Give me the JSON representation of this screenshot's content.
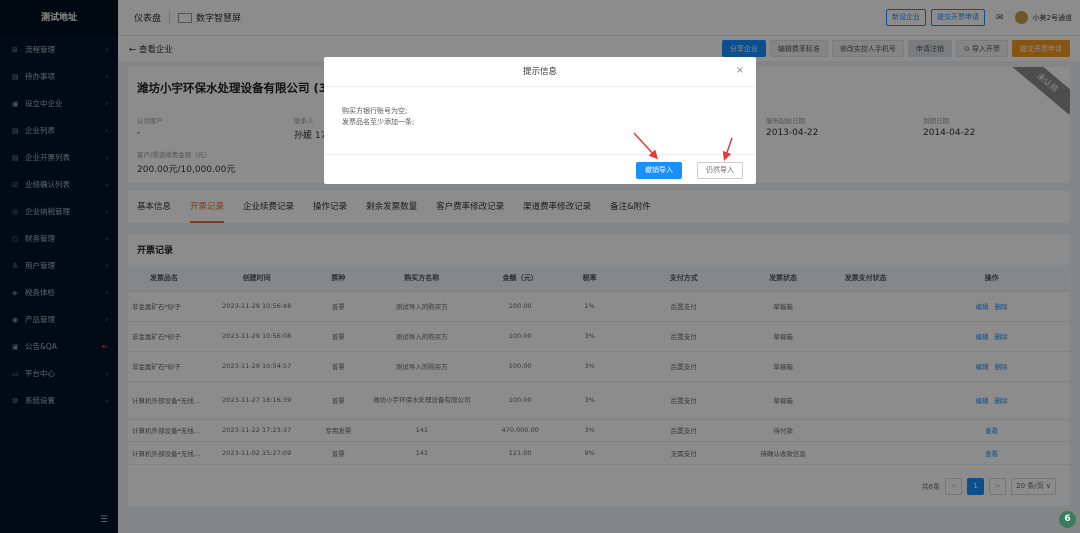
{
  "app": {
    "title": "测试地址"
  },
  "sidebar": {
    "items": [
      {
        "label": "流程管理",
        "icon": "flow-icon"
      },
      {
        "label": "待办事项",
        "icon": "todo-icon"
      },
      {
        "label": "设立中企业",
        "icon": "building-icon"
      },
      {
        "label": "企业列表",
        "icon": "list-icon"
      },
      {
        "label": "企业开票列表",
        "icon": "invoice-icon"
      },
      {
        "label": "业绩确认列表",
        "icon": "check-icon"
      },
      {
        "label": "企业纳税管理",
        "icon": "tax-icon"
      },
      {
        "label": "财务管理",
        "icon": "finance-icon"
      },
      {
        "label": "用户管理",
        "icon": "user-icon"
      },
      {
        "label": "税务体检",
        "icon": "health-icon"
      },
      {
        "label": "产品管理",
        "icon": "product-icon"
      },
      {
        "label": "公告&QA",
        "icon": "notice-icon"
      },
      {
        "label": "平台中心",
        "icon": "platform-icon"
      },
      {
        "label": "系统设置",
        "icon": "settings-icon"
      }
    ],
    "collapse_icon": "collapse-menu-icon"
  },
  "header": {
    "tab1": "仪表盘",
    "tab2": "数字智慧屏",
    "btn_new": "新设企业",
    "btn_invoice": "提交开票申请",
    "user": "小美2号通道"
  },
  "subbar": {
    "back": "← 查看企业",
    "actions": [
      "分享企业",
      "编辑费率标准",
      "修改实控人手机号",
      "申请注销",
      "⊙ 导入开票",
      "提交开票申请"
    ]
  },
  "company": {
    "name": "潍坊小宇环保水处理设备有限公司 (37",
    "badge": "未认领",
    "fields": [
      {
        "k": "认领客户",
        "v": "-"
      },
      {
        "k": "联系人",
        "v": "孙媛 17"
      },
      {
        "k": "服务起始日期",
        "v": "2013-04-22"
      },
      {
        "k": "到期日期",
        "v": "2014-04-22"
      },
      {
        "k": "客户/渠道续费金额（元）",
        "v": "200.00元/10,000.00元"
      }
    ]
  },
  "tabs": [
    "基本信息",
    "开票记录",
    "企业续费记录",
    "操作记录",
    "剩余发票数量",
    "客户费率修改记录",
    "渠道费率修改记录",
    "备注&附件"
  ],
  "records": {
    "title": "开票记录",
    "columns": [
      "发票品名",
      "创建时间",
      "票种",
      "购买方名称",
      "金额（元）",
      "税率",
      "支付方式",
      "发票状态",
      "发票支付状态",
      "操作"
    ],
    "rows": [
      {
        "cells": [
          "非金属矿石*砂子",
          "2023-11-29 10:56:48",
          "普票",
          "测试导入的购买方",
          "100.00",
          "1%",
          "后置支付",
          "草稿箱",
          ""
        ],
        "ops": [
          "编辑",
          "删除"
        ]
      },
      {
        "cells": [
          "非金属矿石*砂子",
          "2023-11-29 10:56:08",
          "普票",
          "测试导入的购买方",
          "100.00",
          "3%",
          "后置支付",
          "草稿箱",
          ""
        ],
        "ops": [
          "编辑",
          "删除"
        ]
      },
      {
        "cells": [
          "非金属矿石*砂子",
          "2023-11-29 10:54:57",
          "普票",
          "测试导入的购买方",
          "100.00",
          "3%",
          "后置支付",
          "草稿箱",
          ""
        ],
        "ops": [
          "编辑",
          "删除"
        ]
      },
      {
        "cells": [
          "计算机外部设备*无线...",
          "2023-11-27 18:16:39",
          "普票",
          "潍坊小宇环保水处理设备有限公司",
          "100.00",
          "3%",
          "后置支付",
          "草稿箱",
          ""
        ],
        "ops": [
          "编辑",
          "删除"
        ]
      },
      {
        "cells": [
          "计算机外部设备*无线...",
          "2023-11-22 17:23:37",
          "专用发票",
          "141",
          "470,000.00",
          "3%",
          "后置支付",
          "待付款",
          ""
        ],
        "ops": [
          "查看"
        ]
      },
      {
        "cells": [
          "计算机外部设备*无线...",
          "2023-11-02 15:27:09",
          "普票",
          "141",
          "121.00",
          "9%",
          "无需支付",
          "待确认收款信息",
          ""
        ],
        "ops": [
          "查看"
        ]
      }
    ],
    "pager": {
      "total": "共6条",
      "prev": "<",
      "page": "1",
      "next": ">",
      "size": "20 条/页 ∨"
    }
  },
  "dialog": {
    "title": "提示信息",
    "close": "×",
    "line1": "购买方银行账号为空;",
    "line2": "发票品名至少添加一条;",
    "btn_cancel_import": "撤销导入",
    "btn_still_import": "仍然导入"
  },
  "page_number": "6",
  "colors": {
    "accent": "#1890ff",
    "active_tab": "#f56c2d",
    "sidebar": "#001529",
    "arrow": "#e53935"
  }
}
